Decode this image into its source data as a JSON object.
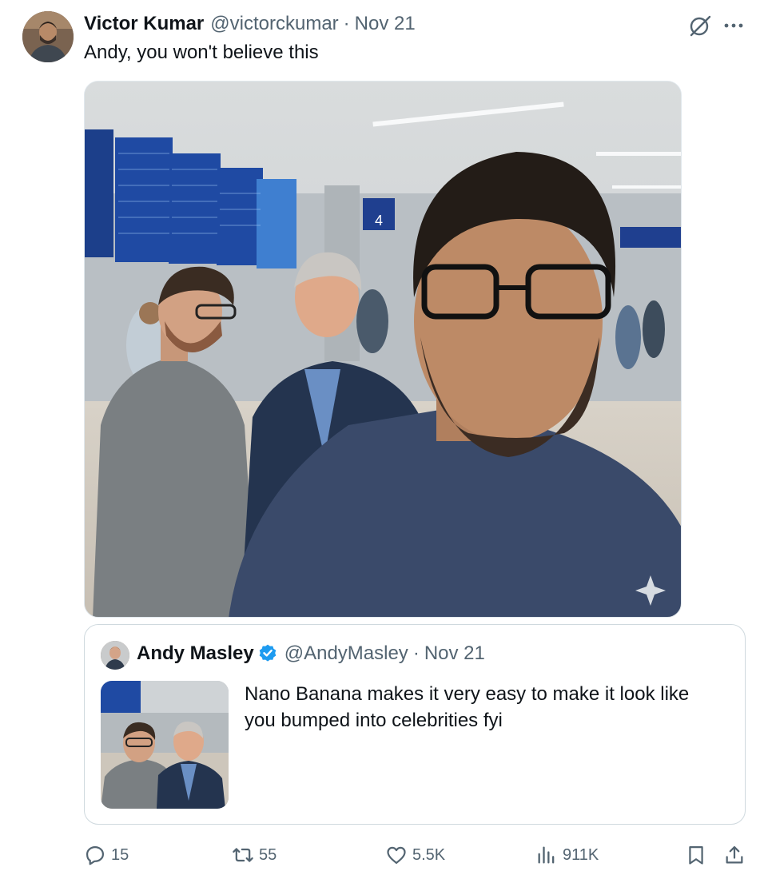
{
  "post": {
    "author_name": "Victor Kumar",
    "author_handle": "@victorckumar",
    "separator": "·",
    "date": "Nov 21",
    "text": "Andy, you won't believe this",
    "media_gate_number": "4"
  },
  "quoted_post": {
    "author_name": "Andy Masley",
    "author_handle": "@AndyMasley",
    "separator": "·",
    "date": "Nov 21",
    "text": "Nano Banana makes it very easy to make it look like you bumped into celebrities fyi",
    "verified": true
  },
  "actions": {
    "replies": "15",
    "reposts": "55",
    "likes": "5.5K",
    "views": "911K"
  },
  "icons": {
    "reply": "reply-icon",
    "repost": "repost-icon",
    "like": "heart-icon",
    "views": "views-icon",
    "bookmark": "bookmark-icon",
    "share": "share-icon",
    "grok": "grok-icon",
    "more": "more-icon",
    "verified": "verified-badge-icon"
  },
  "colors": {
    "text_primary": "#0f1419",
    "text_secondary": "#536471",
    "verified_blue": "#1d9bf0",
    "border": "#cfd9de"
  }
}
